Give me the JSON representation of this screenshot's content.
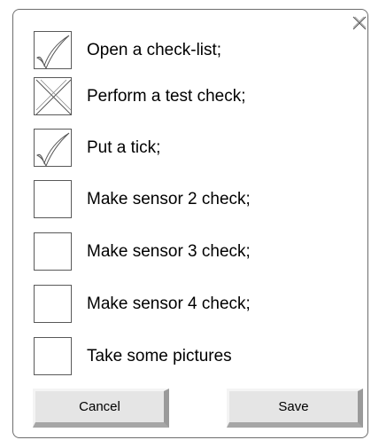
{
  "items": [
    {
      "label": "Open a check-list;",
      "state": "checked"
    },
    {
      "label": "Perform a test check;",
      "state": "crossed"
    },
    {
      "label": "Put a tick;",
      "state": "checked"
    },
    {
      "label": "Make sensor 2 check;",
      "state": "empty"
    },
    {
      "label": "Make sensor 3 check;",
      "state": "empty"
    },
    {
      "label": "Make sensor 4 check;",
      "state": "empty"
    },
    {
      "label": "Take some pictures",
      "state": "empty"
    }
  ],
  "buttons": {
    "cancel": "Cancel",
    "save": "Save"
  }
}
